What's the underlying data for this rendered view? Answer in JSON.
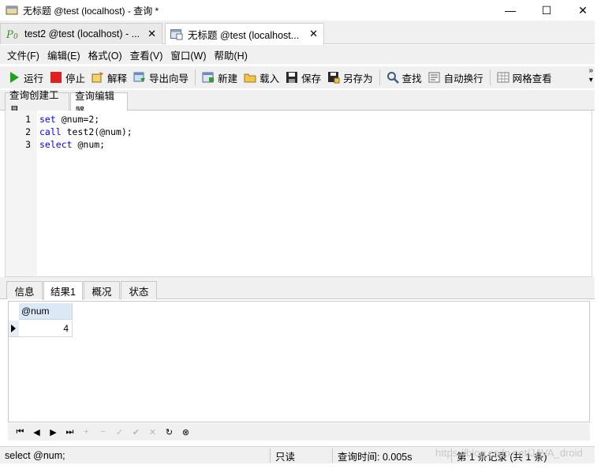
{
  "window": {
    "title": "无标题 @test (localhost) - 查询 *",
    "controls": {
      "minimize": "—",
      "maximize": "☐",
      "close": "✕"
    }
  },
  "doc_tabs": [
    {
      "label": "test2 @test (localhost) - ...",
      "close": "✕",
      "icon": "procedure-icon"
    },
    {
      "label": "无标题 @test (localhost...",
      "close": "✕",
      "icon": "query-icon"
    }
  ],
  "menu": [
    {
      "label": "文件(F)"
    },
    {
      "label": "编辑(E)"
    },
    {
      "label": "格式(O)"
    },
    {
      "label": "查看(V)"
    },
    {
      "label": "窗口(W)"
    },
    {
      "label": "帮助(H)"
    }
  ],
  "toolbar": {
    "run": "运行",
    "stop": "停止",
    "explain": "解释",
    "export_wizard": "导出向导",
    "new": "新建",
    "load": "载入",
    "save": "保存",
    "save_as": "另存为",
    "find": "查找",
    "word_wrap": "自动换行",
    "grid_view": "网格查看"
  },
  "sub_tabs": [
    {
      "label": "查询创建工具"
    },
    {
      "label": "查询编辑器"
    }
  ],
  "editor": {
    "line_numbers": [
      "1",
      "2",
      "3"
    ],
    "lines": [
      {
        "kw": "set",
        "rest": " @num=2;"
      },
      {
        "kw": "call",
        "rest": " test2(@num);"
      },
      {
        "kw": "select",
        "rest": " @num;"
      }
    ]
  },
  "result_tabs": [
    {
      "label": "信息"
    },
    {
      "label": "结果1"
    },
    {
      "label": "概况"
    },
    {
      "label": "状态"
    }
  ],
  "grid": {
    "columns": [
      "@num"
    ],
    "rows": [
      [
        "4"
      ]
    ]
  },
  "nav": {
    "first": "⏮",
    "prev": "◀",
    "next": "▶",
    "last": "⏭",
    "add": "+",
    "delete": "−",
    "edit": "✓",
    "apply": "✔",
    "cancel": "✕",
    "refresh": "↻",
    "stop": "⊗"
  },
  "status": {
    "query": "select @num;",
    "mode": "只读",
    "query_time": "查询时间: 0.005s",
    "record_info": "第 1 条记录 (共 1 条)"
  },
  "watermark": "https://blog.csdn.net/JAVA_droid",
  "colors": {
    "keyword": "#0000ff",
    "run": "#1aa51a",
    "stop": "#e02020",
    "header_bg": "#dbe9f7"
  }
}
